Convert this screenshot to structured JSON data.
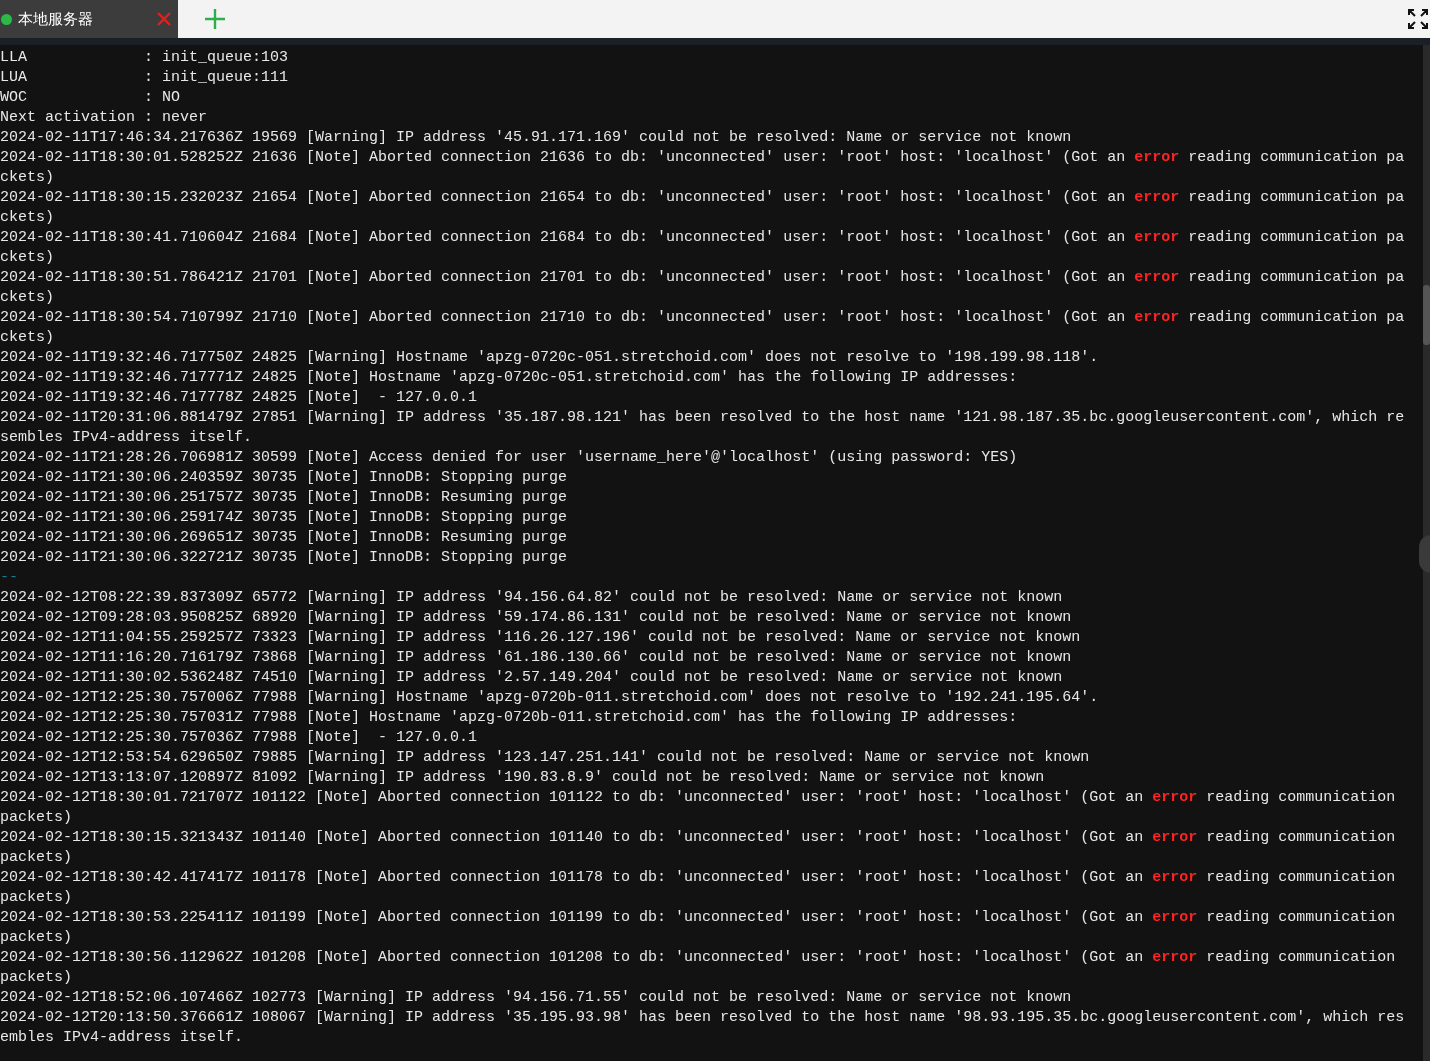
{
  "tabs": [
    {
      "label": "本地服务器",
      "selected": true,
      "connected": true
    }
  ],
  "terminal": {
    "lines": [
      {
        "kind": "text",
        "text": "LLA             : init_queue:103"
      },
      {
        "kind": "text",
        "text": "LUA             : init_queue:111"
      },
      {
        "kind": "text",
        "text": "WOC             : NO"
      },
      {
        "kind": "text",
        "text": "Next activation : never"
      },
      {
        "kind": "text",
        "text": "2024-02-11T17:46:34.217636Z 19569 [Warning] IP address '45.91.171.169' could not be resolved: Name or service not known"
      },
      {
        "kind": "text",
        "text": "2024-02-11T18:30:01.528252Z 21636 [Note] Aborted connection 21636 to db: 'unconnected' user: 'root' host: 'localhost' (Got an **error** reading communication packets)"
      },
      {
        "kind": "text",
        "text": "2024-02-11T18:30:15.232023Z 21654 [Note] Aborted connection 21654 to db: 'unconnected' user: 'root' host: 'localhost' (Got an **error** reading communication packets)"
      },
      {
        "kind": "text",
        "text": "2024-02-11T18:30:41.710604Z 21684 [Note] Aborted connection 21684 to db: 'unconnected' user: 'root' host: 'localhost' (Got an **error** reading communication packets)"
      },
      {
        "kind": "text",
        "text": "2024-02-11T18:30:51.786421Z 21701 [Note] Aborted connection 21701 to db: 'unconnected' user: 'root' host: 'localhost' (Got an **error** reading communication packets)"
      },
      {
        "kind": "text",
        "text": "2024-02-11T18:30:54.710799Z 21710 [Note] Aborted connection 21710 to db: 'unconnected' user: 'root' host: 'localhost' (Got an **error** reading communication packets)"
      },
      {
        "kind": "text",
        "text": "2024-02-11T19:32:46.717750Z 24825 [Warning] Hostname 'apzg-0720c-051.stretchoid.com' does not resolve to '198.199.98.118'."
      },
      {
        "kind": "text",
        "text": "2024-02-11T19:32:46.717771Z 24825 [Note] Hostname 'apzg-0720c-051.stretchoid.com' has the following IP addresses:"
      },
      {
        "kind": "text",
        "text": "2024-02-11T19:32:46.717778Z 24825 [Note]  - 127.0.0.1"
      },
      {
        "kind": "text",
        "text": "2024-02-11T20:31:06.881479Z 27851 [Warning] IP address '35.187.98.121' has been resolved to the host name '121.98.187.35.bc.googleusercontent.com', which resembles IPv4-address itself."
      },
      {
        "kind": "text",
        "text": "2024-02-11T21:28:26.706981Z 30599 [Note] Access denied for user 'username_here'@'localhost' (using password: YES)"
      },
      {
        "kind": "text",
        "text": "2024-02-11T21:30:06.240359Z 30735 [Note] InnoDB: Stopping purge"
      },
      {
        "kind": "text",
        "text": "2024-02-11T21:30:06.251757Z 30735 [Note] InnoDB: Resuming purge"
      },
      {
        "kind": "text",
        "text": "2024-02-11T21:30:06.259174Z 30735 [Note] InnoDB: Stopping purge"
      },
      {
        "kind": "text",
        "text": "2024-02-11T21:30:06.269651Z 30735 [Note] InnoDB: Resuming purge"
      },
      {
        "kind": "text",
        "text": "2024-02-11T21:30:06.322721Z 30735 [Note] InnoDB: Stopping purge"
      },
      {
        "kind": "separator",
        "text": "--"
      },
      {
        "kind": "text",
        "text": "2024-02-12T08:22:39.837309Z 65772 [Warning] IP address '94.156.64.82' could not be resolved: Name or service not known"
      },
      {
        "kind": "text",
        "text": "2024-02-12T09:28:03.950825Z 68920 [Warning] IP address '59.174.86.131' could not be resolved: Name or service not known"
      },
      {
        "kind": "text",
        "text": "2024-02-12T11:04:55.259257Z 73323 [Warning] IP address '116.26.127.196' could not be resolved: Name or service not known"
      },
      {
        "kind": "text",
        "text": "2024-02-12T11:16:20.716179Z 73868 [Warning] IP address '61.186.130.66' could not be resolved: Name or service not known"
      },
      {
        "kind": "text",
        "text": "2024-02-12T11:30:02.536248Z 74510 [Warning] IP address '2.57.149.204' could not be resolved: Name or service not known"
      },
      {
        "kind": "text",
        "text": "2024-02-12T12:25:30.757006Z 77988 [Warning] Hostname 'apzg-0720b-011.stretchoid.com' does not resolve to '192.241.195.64'."
      },
      {
        "kind": "text",
        "text": "2024-02-12T12:25:30.757031Z 77988 [Note] Hostname 'apzg-0720b-011.stretchoid.com' has the following IP addresses:"
      },
      {
        "kind": "text",
        "text": "2024-02-12T12:25:30.757036Z 77988 [Note]  - 127.0.0.1"
      },
      {
        "kind": "text",
        "text": "2024-02-12T12:53:54.629650Z 79885 [Warning] IP address '123.147.251.141' could not be resolved: Name or service not known"
      },
      {
        "kind": "text",
        "text": "2024-02-12T13:13:07.120897Z 81092 [Warning] IP address '190.83.8.9' could not be resolved: Name or service not known"
      },
      {
        "kind": "text",
        "text": "2024-02-12T18:30:01.721707Z 101122 [Note] Aborted connection 101122 to db: 'unconnected' user: 'root' host: 'localhost' (Got an **error** reading communication packets)"
      },
      {
        "kind": "text",
        "text": "2024-02-12T18:30:15.321343Z 101140 [Note] Aborted connection 101140 to db: 'unconnected' user: 'root' host: 'localhost' (Got an **error** reading communication packets)"
      },
      {
        "kind": "text",
        "text": "2024-02-12T18:30:42.417417Z 101178 [Note] Aborted connection 101178 to db: 'unconnected' user: 'root' host: 'localhost' (Got an **error** reading communication packets)"
      },
      {
        "kind": "text",
        "text": "2024-02-12T18:30:53.225411Z 101199 [Note] Aborted connection 101199 to db: 'unconnected' user: 'root' host: 'localhost' (Got an **error** reading communication packets)"
      },
      {
        "kind": "text",
        "text": "2024-02-12T18:30:56.112962Z 101208 [Note] Aborted connection 101208 to db: 'unconnected' user: 'root' host: 'localhost' (Got an **error** reading communication packets)"
      },
      {
        "kind": "text",
        "text": "2024-02-12T18:52:06.107466Z 102773 [Warning] IP address '94.156.71.55' could not be resolved: Name or service not known"
      },
      {
        "kind": "text",
        "text": "2024-02-12T20:13:50.376661Z 108067 [Warning] IP address '35.195.93.98' has been resolved to the host name '98.93.195.35.bc.googleusercontent.com', which resembles IPv4-address itself."
      }
    ]
  }
}
